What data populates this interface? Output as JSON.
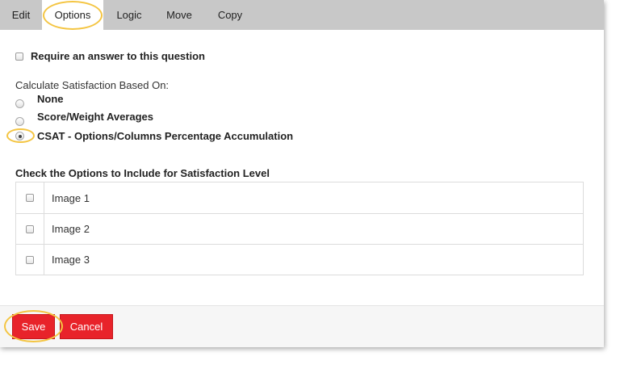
{
  "tabs": [
    {
      "label": "Edit"
    },
    {
      "label": "Options"
    },
    {
      "label": "Logic"
    },
    {
      "label": "Move"
    },
    {
      "label": "Copy"
    }
  ],
  "active_tab": "Options",
  "require_answer": {
    "label": "Require an answer to this question",
    "checked": false
  },
  "satisfaction": {
    "heading": "Calculate Satisfaction Based On:",
    "options": [
      {
        "label": "None",
        "selected": false
      },
      {
        "label": "Score/Weight Averages",
        "selected": false
      },
      {
        "label": "CSAT - Options/Columns Percentage Accumulation",
        "selected": true
      }
    ]
  },
  "options_table": {
    "heading": "Check the Options to Include for Satisfaction Level",
    "rows": [
      {
        "label": "Image 1",
        "checked": false
      },
      {
        "label": "Image 2",
        "checked": false
      },
      {
        "label": "Image 3",
        "checked": false
      }
    ]
  },
  "footer": {
    "save_label": "Save",
    "cancel_label": "Cancel"
  },
  "colors": {
    "accent": "#e8232a",
    "highlight_ring": "#f4c542",
    "tab_bar": "#c8c8c8"
  }
}
